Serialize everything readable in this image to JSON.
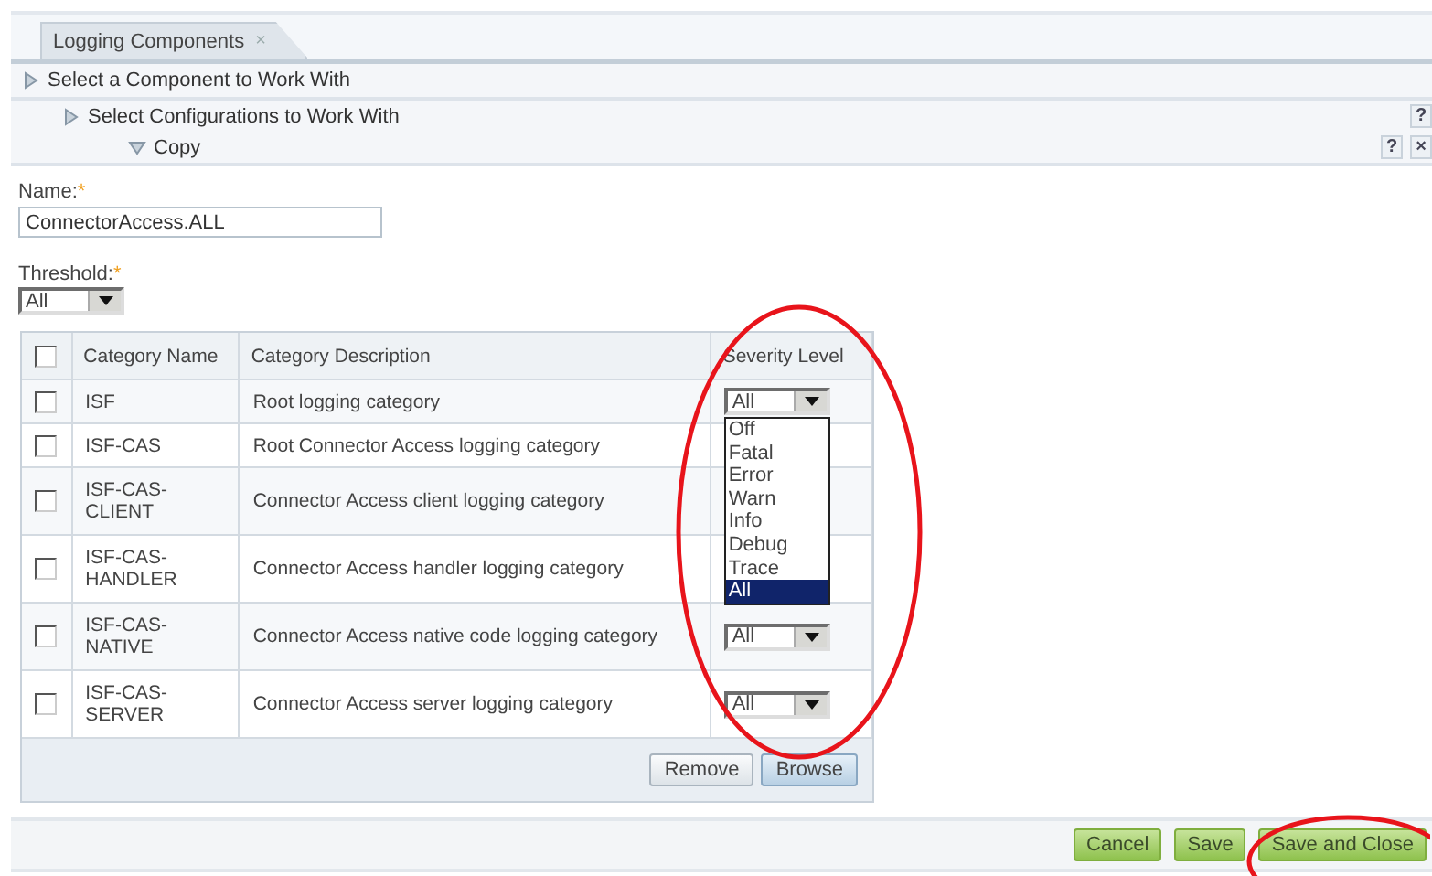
{
  "tabs": [
    {
      "label": "Logging Components",
      "close": "×",
      "selected": true
    }
  ],
  "train": [
    {
      "label": "Select a Component to Work With",
      "expanded": false,
      "children": [
        {
          "label": "Select Configurations to Work With",
          "expanded": false,
          "help": "?",
          "children": [
            {
              "label": "Copy",
              "expanded": true,
              "help": "?",
              "close": "×"
            }
          ]
        }
      ]
    }
  ],
  "form": {
    "name": {
      "label": "Name:",
      "required": "*",
      "value": "ConnectorAccess.ALL"
    },
    "threshold": {
      "label": "Threshold:",
      "required": "*",
      "value": "All"
    }
  },
  "table": {
    "columns": [
      {
        "kind": "check",
        "checked": false
      },
      {
        "kind": "text",
        "label": "Category Name"
      },
      {
        "kind": "text",
        "label": "Category Description"
      },
      {
        "kind": "select",
        "label": "Severity Level",
        "highlighted": true
      }
    ],
    "rows": [
      {
        "checked": false,
        "name": "ISF",
        "description": "Root logging category",
        "severity": "All",
        "options": [
          {
            "label": "Off",
            "selected": false
          },
          {
            "label": "Fatal",
            "selected": false
          },
          {
            "label": "Error",
            "selected": false
          },
          {
            "label": "Warn",
            "selected": false
          },
          {
            "label": "Info",
            "selected": false
          },
          {
            "label": "Debug",
            "selected": false
          },
          {
            "label": "Trace",
            "selected": false
          },
          {
            "label": "All",
            "selected": true
          }
        ]
      },
      {
        "checked": false,
        "name": "ISF-CAS",
        "description": "Root Connector Access logging category"
      },
      {
        "checked": false,
        "name": "ISF-CAS-CLIENT",
        "description": "Connector Access client logging category"
      },
      {
        "checked": false,
        "name": "ISF-CAS-HANDLER",
        "description": "Connector Access handler logging category"
      },
      {
        "checked": false,
        "name": "ISF-CAS-NATIVE",
        "description": "Connector Access native code logging category",
        "severity": "All"
      },
      {
        "checked": false,
        "name": "ISF-CAS-SERVER",
        "description": "Connector Access server logging category",
        "severity": "All"
      }
    ],
    "buttons": [
      {
        "label": "Remove",
        "kind": "plain"
      },
      {
        "label": "Browse",
        "kind": "accent"
      }
    ]
  },
  "footer": {
    "buttons": [
      {
        "label": "Cancel",
        "highlighted": false
      },
      {
        "label": "Save",
        "highlighted": false
      },
      {
        "label": "Save and Close",
        "highlighted": true
      }
    ]
  }
}
